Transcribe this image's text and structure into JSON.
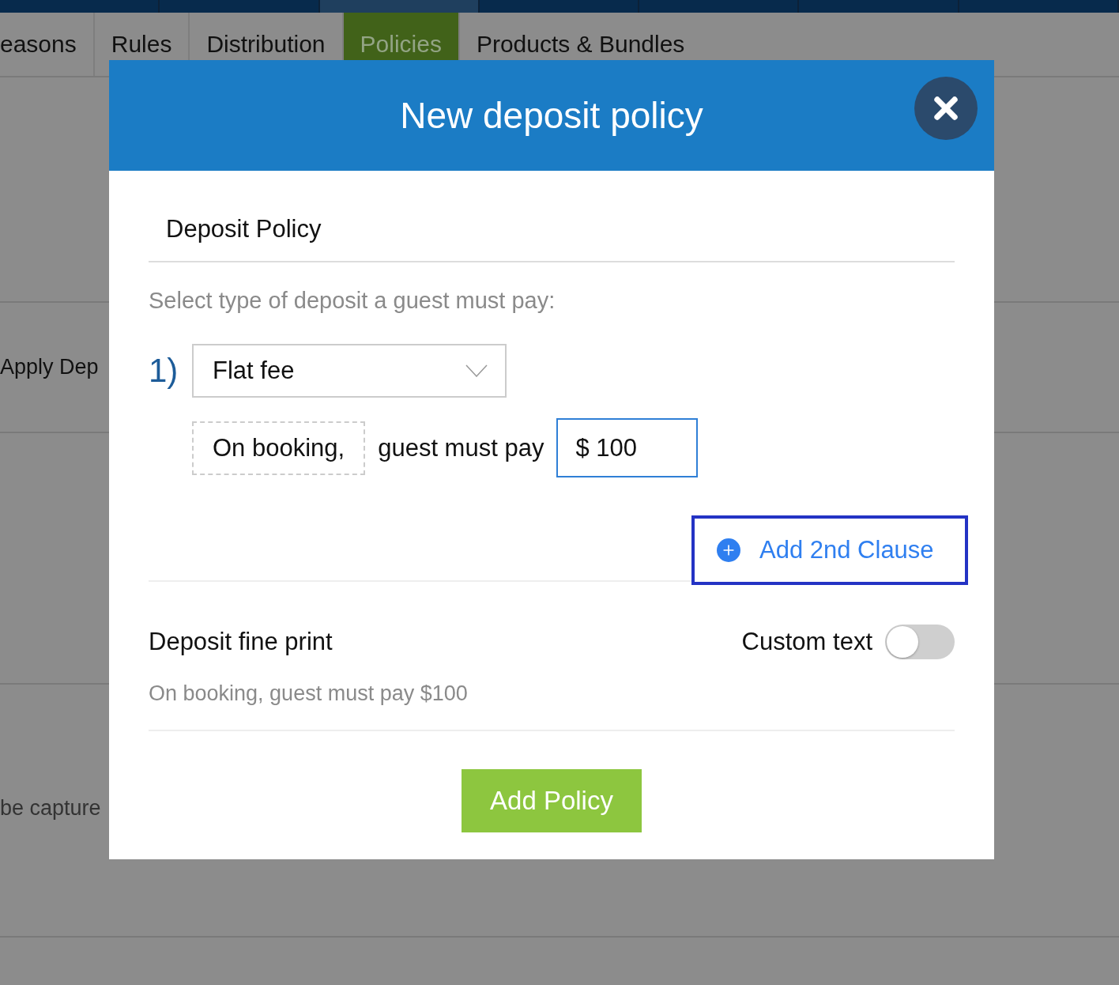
{
  "tabs": [
    {
      "label": "easons",
      "selected": false
    },
    {
      "label": "Rules",
      "selected": false
    },
    {
      "label": "Distribution",
      "selected": false
    },
    {
      "label": "Policies",
      "selected": true
    },
    {
      "label": "Products & Bundles",
      "selected": false
    }
  ],
  "background_rows": [
    {
      "text": "Apply Dep"
    },
    {
      "text": "be capture"
    }
  ],
  "modal": {
    "title": "New deposit policy",
    "section_title": "Deposit Policy",
    "prompt": "Select type of deposit a guest must pay:",
    "clauses": [
      {
        "number": "1)",
        "type": "Flat fee",
        "timing": "On booking,",
        "connector": "guest must pay",
        "amount": "$ 100"
      }
    ],
    "add_clause": "Add 2nd Clause",
    "fine_print": {
      "title": "Deposit fine print",
      "custom_text_label": "Custom text",
      "custom_text_on": false,
      "text": "On booking, guest must pay $100"
    },
    "submit": "Add Policy"
  }
}
